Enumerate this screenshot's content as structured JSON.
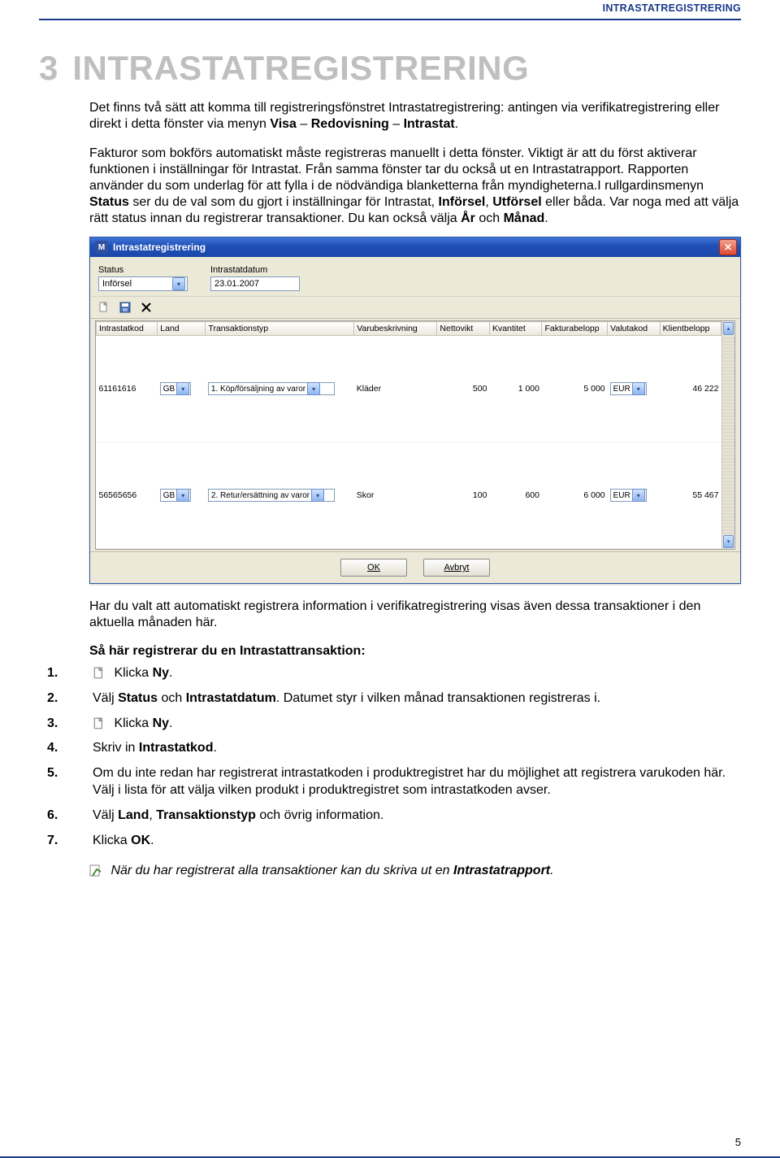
{
  "header_right": "INTRASTATREGISTRERING",
  "chapter": {
    "num": "3",
    "title": "INTRASTATREGISTRERING"
  },
  "para1_a": "Det finns två sätt att komma till registreringsfönstret Intrastatregistrering: antingen via verifikatregistrering eller direkt i detta fönster via menyn ",
  "para1_b1": "Visa",
  "para1_sep": " – ",
  "para1_b2": "Redovisning",
  "para1_sep2": " – ",
  "para1_b3": "Intrastat",
  "para1_end": ".",
  "para2_a": "Fakturor som bokförs automatiskt måste registreras manuellt i detta fönster. Viktigt är att du först aktiverar funktionen i inställningar för Intrastat. Från samma fönster tar du också ut en Intrastatrapport. Rapporten använder du som underlag för att fylla i de nödvändiga blanketterna från myndigheterna.I rullgardinsmenyn ",
  "para2_b1": "Status",
  "para2_b": " ser du de val som du gjort i inställningar för Intrastat, ",
  "para2_b2": "Införsel",
  "para2_c": ", ",
  "para2_b3": "Utförsel",
  "para2_d": " eller båda. Var noga med att välja rätt status innan du registrerar transaktioner. Du kan också välja ",
  "para2_b4": "År",
  "para2_e": " och ",
  "para2_b5": "Månad",
  "para2_f": ".",
  "window": {
    "title": "Intrastatregistrering",
    "labels": {
      "status": "Status",
      "date": "Intrastatdatum"
    },
    "status_value": "Införsel",
    "date_value": "23.01.2007",
    "columns": {
      "c0": "Intrastatkod",
      "c1": "Land",
      "c2": "Transaktionstyp",
      "c3": "Varubeskrivning",
      "c4": "Nettovikt",
      "c5": "Kvantitet",
      "c6": "Fakturabelopp",
      "c7": "Valutakod",
      "c8": "Klientbelopp"
    },
    "rows": [
      {
        "kod": "61161616",
        "land": "GB",
        "typ": "1. Köp/försäljning av varor",
        "besk": "Kläder",
        "vikt": "500",
        "kvant": "1 000",
        "belopp": "5 000",
        "val": "EUR",
        "klient": "46 222"
      },
      {
        "kod": "56565656",
        "land": "GB",
        "typ": "2. Retur/ersättning av varor",
        "besk": "Skor",
        "vikt": "100",
        "kvant": "600",
        "belopp": "6 000",
        "val": "EUR",
        "klient": "55 467"
      }
    ],
    "buttons": {
      "ok": "OK",
      "cancel": "Avbryt"
    }
  },
  "after1": "Har du valt att automatiskt registrera information i verifikatregistrering visas även dessa transaktioner i den aktuella månaden här.",
  "subheading": "Så här registrerar du en Intrastattransaktion:",
  "steps": {
    "s1a": "Klicka ",
    "s1b": "Ny",
    "s1c": ".",
    "s2a": "Välj ",
    "s2b1": "Status",
    "s2m": " och ",
    "s2b2": "Intrastatdatum",
    "s2c": ". Datumet styr i vilken månad transaktionen registreras i.",
    "s3a": "Klicka ",
    "s3b": "Ny",
    "s3c": ".",
    "s4a": "Skriv in ",
    "s4b": "Intrastatkod",
    "s4c": ".",
    "s5": "Om du inte redan har registrerat intrastatkoden i produktregistret har du möjlighet att registrera varukoden här. Välj i lista för att välja vilken produkt i produktregistret som intrastatkoden avser.",
    "s6a": "Välj ",
    "s6b1": "Land",
    "s6m1": ", ",
    "s6b2": "Transaktionstyp",
    "s6m2": " och övrig information.",
    "s7a": "Klicka ",
    "s7b": "OK",
    "s7c": "."
  },
  "note_a": "När du har registrerat alla transaktioner kan du skriva ut en ",
  "note_b": "Intrastatrapport",
  "note_c": ".",
  "page_number": "5",
  "step_nums": {
    "n1": "1.",
    "n2": "2.",
    "n3": "3.",
    "n4": "4.",
    "n5": "5.",
    "n6": "6.",
    "n7": "7."
  }
}
